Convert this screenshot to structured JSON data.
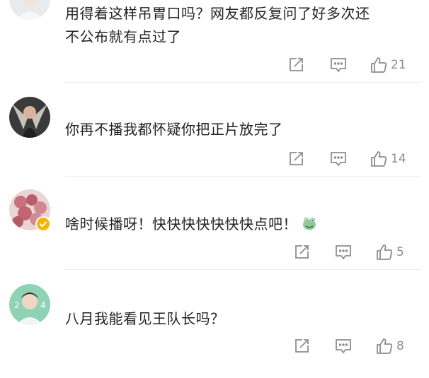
{
  "comments": [
    {
      "text_line1": "用得着这样吊胃口吗？网友都反复问了好多次还",
      "text_line2": "不公布就有点过了",
      "likes": "21"
    },
    {
      "text": "你再不播我都怀疑你把正片放完了",
      "likes": "14"
    },
    {
      "text": "啥时候播呀！快快快快快快快点吧！",
      "likes": "5"
    },
    {
      "text": "八月我能看见王队长吗？",
      "likes": "8"
    }
  ],
  "icons": {
    "share": "share-icon",
    "comment": "comment-icon",
    "like": "thumbs-up-icon",
    "emoji": "frog-emoji-icon",
    "verified": "verified-badge-icon"
  },
  "colors": {
    "icon": "#8d8d8d",
    "text": "#222222",
    "divider": "#ececec",
    "badge": "#f4b400"
  }
}
